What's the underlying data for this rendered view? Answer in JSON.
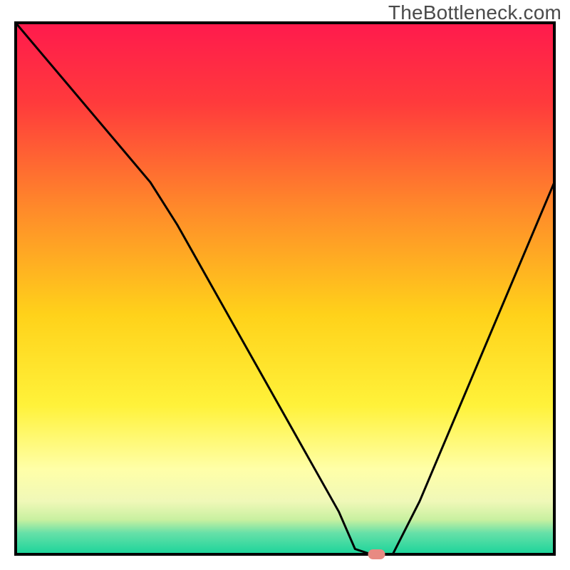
{
  "watermark": "TheBottleneck.com",
  "chart_data": {
    "type": "line",
    "title": "",
    "xlabel": "",
    "ylabel": "",
    "xlim": [
      0,
      100
    ],
    "ylim": [
      0,
      100
    ],
    "series": [
      {
        "name": "bottleneck-curve",
        "x": [
          0,
          5,
          10,
          15,
          20,
          25,
          30,
          35,
          40,
          45,
          50,
          55,
          60,
          63,
          66,
          70,
          75,
          80,
          85,
          90,
          95,
          100
        ],
        "y": [
          100,
          94,
          88,
          82,
          76,
          70,
          62,
          53,
          44,
          35,
          26,
          17,
          8,
          1,
          0,
          0,
          10,
          22,
          34,
          46,
          58,
          70
        ]
      }
    ],
    "marker": {
      "name": "optimal-point",
      "x": 67,
      "y": 0,
      "color": "#e88a82"
    },
    "background_gradient_stops": [
      {
        "offset": 0.0,
        "color": "#ff1a4d"
      },
      {
        "offset": 0.15,
        "color": "#ff3a3c"
      },
      {
        "offset": 0.35,
        "color": "#ff8a2a"
      },
      {
        "offset": 0.55,
        "color": "#ffd21a"
      },
      {
        "offset": 0.72,
        "color": "#fff23a"
      },
      {
        "offset": 0.84,
        "color": "#ffffa8"
      },
      {
        "offset": 0.9,
        "color": "#f0f8b8"
      },
      {
        "offset": 0.935,
        "color": "#c8f0a0"
      },
      {
        "offset": 0.96,
        "color": "#66e0a8"
      },
      {
        "offset": 1.0,
        "color": "#1ad49a"
      }
    ],
    "border_color": "#000000",
    "line_color": "#000000",
    "line_width": 3
  }
}
